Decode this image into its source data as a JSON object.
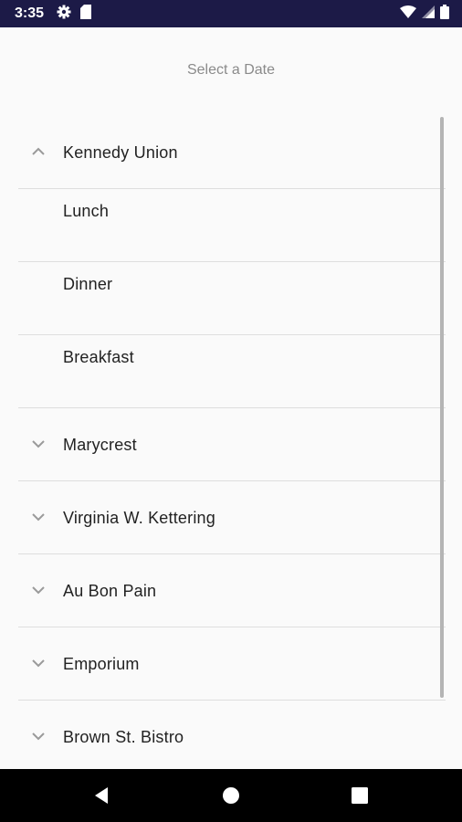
{
  "status_bar": {
    "time": "3:35",
    "left_icons": [
      "settings-gear-icon",
      "sd-card-icon"
    ],
    "right_icons": [
      "wifi-icon",
      "cell-signal-icon",
      "battery-icon"
    ]
  },
  "header": {
    "title": "Select a Date"
  },
  "dining_halls": [
    {
      "name": "Kennedy Union",
      "expanded": true,
      "meals": [
        "Lunch",
        "Dinner",
        "Breakfast"
      ]
    },
    {
      "name": "Marycrest",
      "expanded": false
    },
    {
      "name": "Virginia W. Kettering",
      "expanded": false
    },
    {
      "name": "Au Bon Pain",
      "expanded": false
    },
    {
      "name": "Emporium",
      "expanded": false
    },
    {
      "name": "Brown St. Bistro",
      "expanded": false
    }
  ],
  "nav_bar": {
    "buttons": [
      "back-icon",
      "home-icon",
      "recents-icon"
    ]
  },
  "colors": {
    "status_bar_bg": "#1c1a47",
    "background": "#fafafa",
    "divider": "#dedede",
    "text": "#222222",
    "title_text": "#8a8a8a"
  }
}
